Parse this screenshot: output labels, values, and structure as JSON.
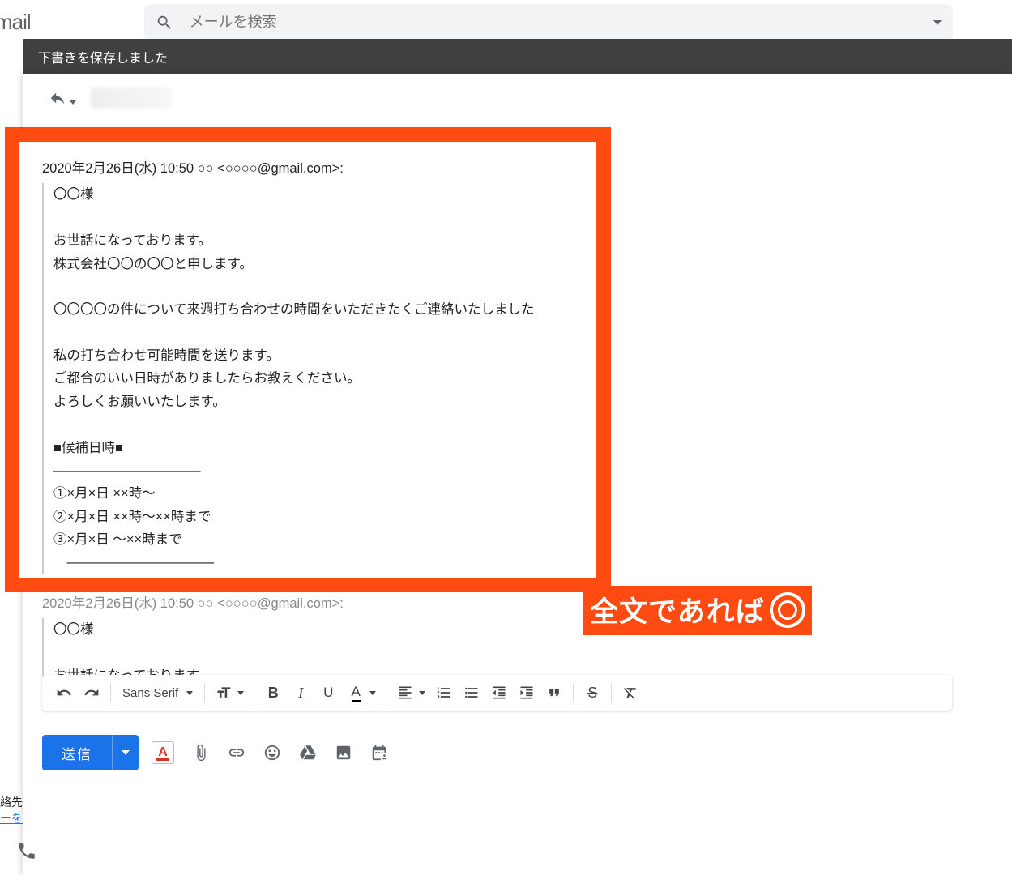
{
  "header": {
    "logo": "mail",
    "search_placeholder": "メールを検索"
  },
  "compose_bar": {
    "status": "下書きを保存しました"
  },
  "quoted_header": "2020年2月26日(水) 10:50 ○○ <○○○○@gmail.com>:",
  "body_lines": {
    "l1": "〇〇様",
    "l2": "お世話になっております。",
    "l3": "株式会社〇〇の〇〇と申します。",
    "l4": "〇〇〇〇の件について来週打ち合わせの時間をいただきたくご連絡いたしました",
    "l5": "私の打ち合わせ可能時間を送ります。",
    "l6": "ご都合のいい日時がありましたらお教えください。",
    "l7": "よろしくお願いいたします。",
    "l8": "■候補日時■",
    "l9": "―――――――――――",
    "l10": "①×月×日 ××時～",
    "l11": "②×月×日 ××時～××時まで",
    "l12": "③×月×日 ～××時まで",
    "l13": "　―――――――――――"
  },
  "badge_text": "全文であれば",
  "lower_header": "2020年2月26日(水) 10:50 ○○ <○○○○@gmail.com>:",
  "lower": {
    "l1": "〇〇様",
    "l2": "お世話になっております。"
  },
  "toolbar": {
    "font": "Sans Serif"
  },
  "send_label": "送信",
  "footer": {
    "a": "絡先",
    "b": "ーを"
  }
}
